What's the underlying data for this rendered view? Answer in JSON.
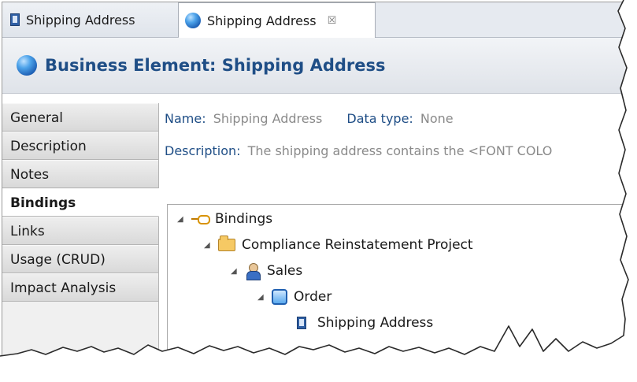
{
  "tabs": [
    {
      "label": "Shipping Address",
      "icon": "attribute-icon",
      "active": false
    },
    {
      "label": "Shipping Address",
      "icon": "business-element-icon",
      "active": true,
      "close": "☒"
    }
  ],
  "header": {
    "title": "Business Element: Shipping Address",
    "icon": "business-element-icon"
  },
  "side_tabs": [
    {
      "label": "General"
    },
    {
      "label": "Description"
    },
    {
      "label": "Notes"
    },
    {
      "label": "Bindings",
      "active": true
    },
    {
      "label": "Links"
    },
    {
      "label": "Usage (CRUD)"
    },
    {
      "label": "Impact Analysis"
    }
  ],
  "fields": {
    "name_label": "Name:",
    "name_value": "Shipping Address",
    "datatype_label": "Data type:",
    "datatype_value": "None",
    "description_label": "Description:",
    "description_value": "The shipping address contains the <FONT COLO"
  },
  "tree": [
    {
      "label": "Bindings",
      "icon": "binding-icon",
      "expanded": true
    },
    {
      "label": "Compliance Reinstatement Project",
      "icon": "folder-icon",
      "expanded": true
    },
    {
      "label": "Sales",
      "icon": "sales-icon",
      "expanded": true
    },
    {
      "label": "Order",
      "icon": "order-icon",
      "expanded": true
    },
    {
      "label": "Shipping Address",
      "icon": "attribute-icon"
    }
  ],
  "colors": {
    "accent": "#1f4e86",
    "muted_value": "#8a8a8a",
    "tab_bg": "#e6eaf0"
  }
}
